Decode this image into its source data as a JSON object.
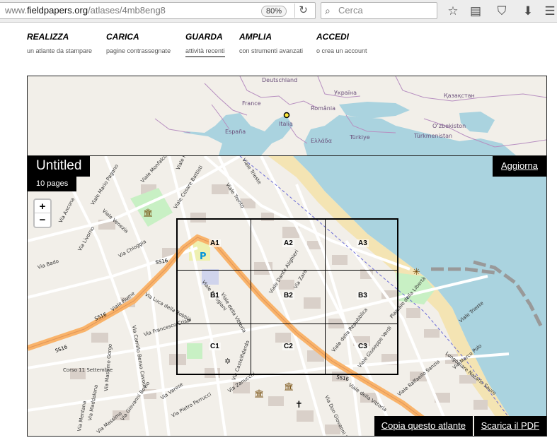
{
  "browser": {
    "url_prefix": "www.",
    "url_host": "fieldpapers.org",
    "url_path": "/atlases/4mb8eng8",
    "zoom": "80%",
    "search_placeholder": "Cerca"
  },
  "nav": [
    {
      "title": "REALIZZA",
      "subtitle": "un atlante da stampare"
    },
    {
      "title": "CARICA",
      "subtitle": "pagine contrassegnate"
    },
    {
      "title": "GUARDA",
      "subtitle": "attività recenti"
    },
    {
      "title": "AMPLIA",
      "subtitle": "con strumenti avanzati"
    },
    {
      "title": "ACCEDI",
      "subtitle": "o crea un account"
    }
  ],
  "atlas": {
    "title": "Untitled",
    "pages": "10 pages",
    "update_label": "Aggiorna",
    "copy_label": "Copia questo atlante",
    "pdf_label": "Scarica il PDF"
  },
  "map_controls": {
    "zoom_in": "+",
    "zoom_out": "−"
  },
  "overview_labels": {
    "deutschland": "Deutschland",
    "ukraina": "Україна",
    "kazakhstan": "Қазақстан",
    "france": "France",
    "romania": "România",
    "italia": "Italia",
    "espana": "España",
    "ellada": "Ελλάδα",
    "turkiye": "Türkiye",
    "ozbekiston": "O‘zbekiston",
    "turkmenistan": "Türkmenistan"
  },
  "grid_labels": [
    "A1",
    "A2",
    "A3",
    "B1",
    "B2",
    "B3",
    "C1",
    "C2",
    "C3"
  ],
  "street_labels": {
    "ss16_a": "SS16",
    "ss16_b": "SS16",
    "ss16_c": "SS16",
    "ss16_d": "SS16",
    "viale_fiume": "Viale Fiume",
    "viale_della_vittoria": "Viale della Vittoria",
    "viale_monfalcone": "Viale Monfalcone",
    "viale_trieste": "Viale Trieste",
    "viale_trento": "Viale Trento",
    "viale_cesare_battisti": "Viale Cesare Battisti",
    "viale_pola": "Viale Pola",
    "via_ancona": "Via Ancona",
    "viale_mario_pagano": "Viale Mario Pagano",
    "viale_venezia": "Viale Venezia",
    "via_chioggia": "Via Chioggia",
    "viale_trieste_low": "Viale Trieste",
    "lungomare": "Lungomare Nazario Sauro",
    "corso": "Corso 11 Settembre",
    "via_bado": "Via Bado",
    "via_livorno": "Via Livorno",
    "via_luca_della_robbia": "Via Luca della Robbia",
    "via_francesco_crispi": "Via Francesco Crispi",
    "viale_partigiani": "Viale Partigiani",
    "viale_della_repubblica": "Viale della Repubblica",
    "viale_giuseppe_verdi": "Viale Giuseppe Verdi",
    "piazzale_della_libertà": "Piazzale della Libertà",
    "viale_della_vittoria_b": "Viale della Vittoria",
    "via_zara": "Via Zara",
    "viale_dante": "Viale Dante Alighieri",
    "via_camillo": "Via Camillo Benso Cavour",
    "via_massimo": "Via Massimo Gorgo",
    "via_mentana": "Via Mentana",
    "via_varese": "Via Varese",
    "via_zanucchi": "Via Zanucchi",
    "via_giovanni_bovio": "Via Giovanni Bovio",
    "via_pietro_perrucci": "Via Pietro Perrucci",
    "via_castelfidardo": "Via Castelfidardo",
    "via_marco_polo": "Via Marco Polo",
    "viale_raffaello": "Viale Raffaello Sanzio",
    "via_don_giovanni": "Via Don Giovanni Minzoni",
    "via_maddalena": "Via Maddalena",
    "via_massimo2": "Via Massimo"
  },
  "colors": {
    "sea": "#aad3df",
    "land": "#f2efe9",
    "beach": "#f4e4b3",
    "road_primary": "#f9b36a",
    "park": "#c8f0c4",
    "building": "#d9d0c9",
    "border": "#b78fc0"
  }
}
